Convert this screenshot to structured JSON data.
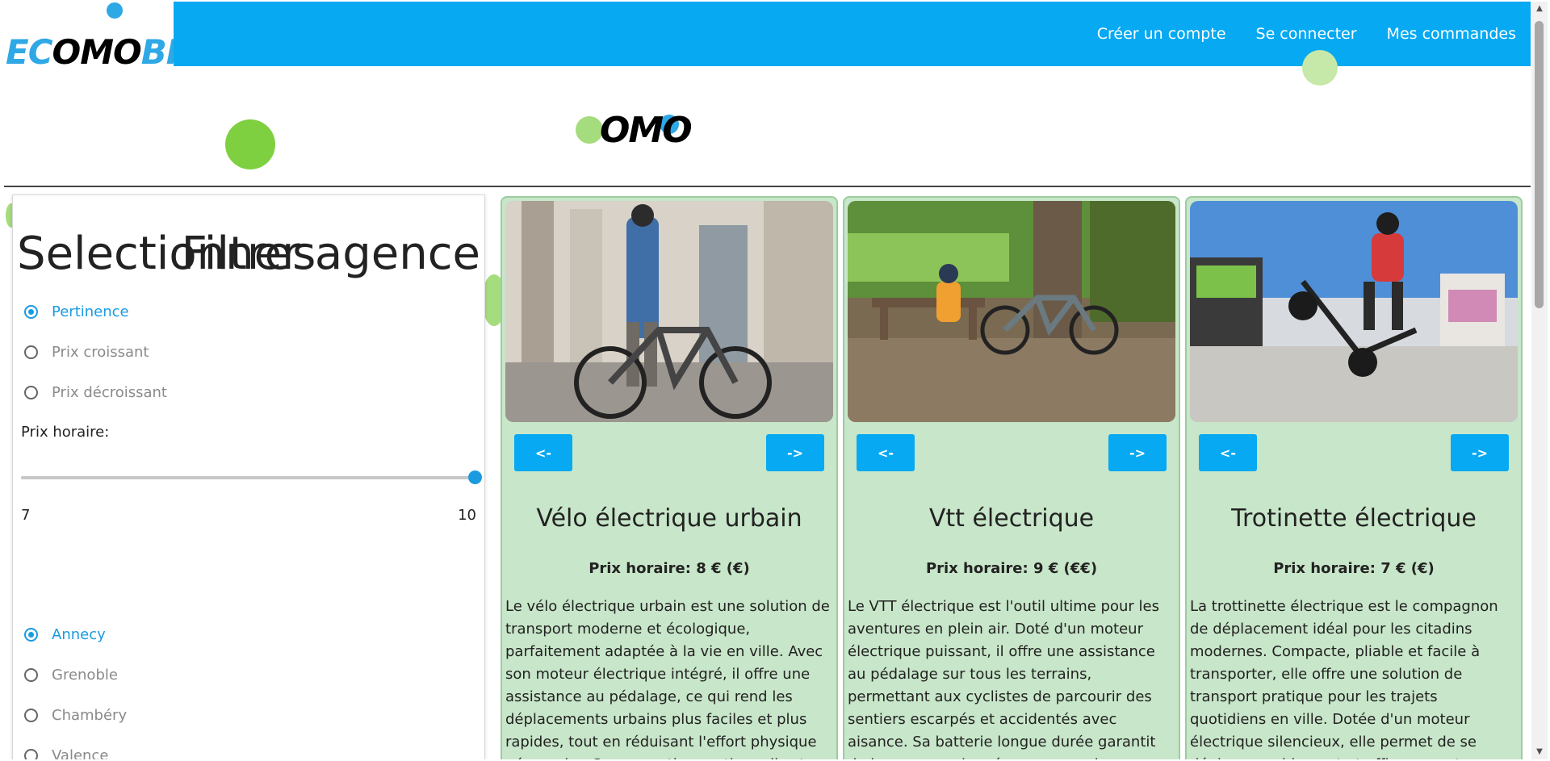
{
  "header": {
    "logo_text": "ECOMOBIL",
    "nav": [
      "Créer un compte",
      "Se connecter",
      "Mes commandes"
    ]
  },
  "banner": {
    "logo_text": "OMO"
  },
  "filters": {
    "title": "Filtres",
    "sort_options": [
      {
        "label": "Pertinence",
        "checked": true
      },
      {
        "label": "Prix croissant",
        "checked": false
      },
      {
        "label": "Prix décroissant",
        "checked": false
      }
    ],
    "price_label": "Prix horaire:",
    "slider": {
      "min": "7",
      "max": "10",
      "value": 10
    },
    "agency_title": "Selectionner agence",
    "agencies": [
      {
        "label": "Annecy",
        "checked": true
      },
      {
        "label": "Grenoble",
        "checked": false
      },
      {
        "label": "Chambéry",
        "checked": false
      },
      {
        "label": "Valence",
        "checked": false
      }
    ]
  },
  "products": [
    {
      "prev": "<-",
      "next": "->",
      "title": "Vélo électrique urbain",
      "price": "Prix horaire: 8 € (€)",
      "description": "Le vélo électrique urbain est une solution de transport moderne et écologique, parfaitement adaptée à la vie en ville. Avec son moteur électrique intégré, il offre une assistance au pédalage, ce qui rend les déplacements urbains plus faciles et plus rapides, tout en réduisant l'effort physique nécessaire. Sa conception pratique, il est"
    },
    {
      "prev": "<-",
      "next": "->",
      "title": "Vtt électrique",
      "price": "Prix horaire: 9 € (€€)",
      "description": "Le VTT électrique est l'outil ultime pour les aventures en plein air. Doté d'un moteur électrique puissant, il offre une assistance au pédalage sur tous les terrains, permettant aux cyclistes de parcourir des sentiers escarpés et accidentés avec aisance. Sa batterie longue durée garantit de longues randonnées sans souci"
    },
    {
      "prev": "<-",
      "next": "->",
      "title": "Trotinette électrique",
      "price": "Prix horaire: 7 € (€)",
      "description": "La trottinette électrique est le compagnon de déplacement idéal pour les citadins modernes. Compacte, pliable et facile à transporter, elle offre une solution de transport pratique pour les trajets quotidiens en ville. Dotée d'un moteur électrique silencieux, elle permet de se déplacer rapidement et efficacement"
    }
  ],
  "colors": {
    "header_bg": "#06a9f2",
    "accent": "#1a9be0",
    "card_bg": "#c8e6c9",
    "deco_green": "#7ed040",
    "deco_light_green": "#a5dc7d"
  }
}
